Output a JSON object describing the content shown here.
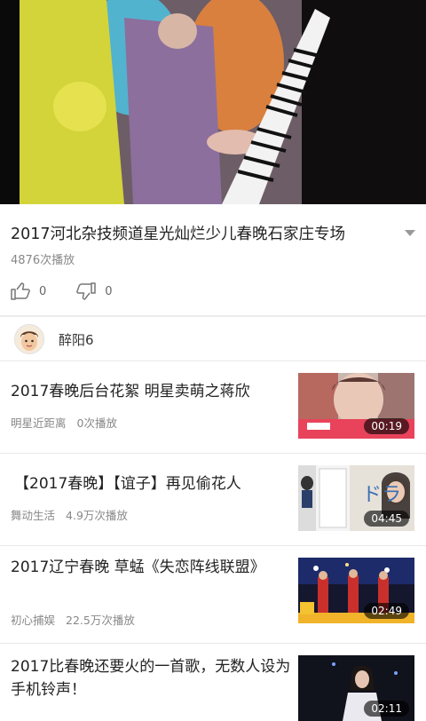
{
  "video": {
    "title": "2017河北杂技频道星光灿烂少儿春晚石家庄专场",
    "play_count": "4876次播放",
    "likes": "0",
    "dislikes": "0"
  },
  "uploader": {
    "name": "醉阳6"
  },
  "related": [
    {
      "title": "2017春晚后台花絮 明星卖萌之蒋欣",
      "channel": "明星近距离",
      "plays": "0次播放",
      "duration": "00:19"
    },
    {
      "title": "【2017春晚】【谊子】再见偷花人",
      "channel": "舞动生活",
      "plays": "4.9万次播放",
      "duration": "04:45"
    },
    {
      "title": "2017辽宁春晚 草蜢《失恋阵线联盟》",
      "channel": "初心捕娱",
      "plays": "22.5万次播放",
      "duration": "02:49"
    },
    {
      "title": "2017比春晚还要火的一首歌，无数人设为手机铃声！",
      "duration": "02:11"
    }
  ],
  "colors": {
    "divider": "#e8e8e8",
    "meta_text": "#888888",
    "accent_pink": "#e8435a"
  }
}
